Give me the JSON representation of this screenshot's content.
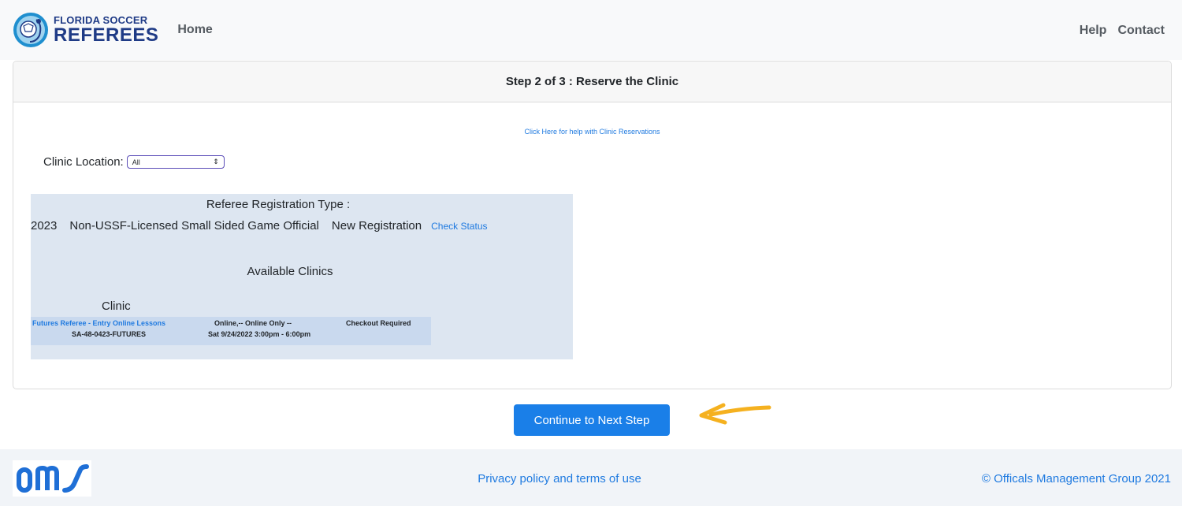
{
  "navbar": {
    "brand_top": "FLORIDA SOCCER",
    "brand_bottom": "REFEREES",
    "home": "Home",
    "help": "Help",
    "contact": "Contact"
  },
  "card": {
    "header": "Step 2 of 3 : Reserve the Clinic",
    "help_link": "Click Here for help with Clinic Reservations",
    "location_label": "Clinic Location:",
    "location_value": "All"
  },
  "registration": {
    "type_label": "Referee Registration Type :",
    "year": "2023",
    "official": "Non-USSF-Licensed Small Sided Game Official",
    "kind": "New Registration",
    "check_status": "Check Status",
    "available_clinics": "Available Clinics",
    "clinic_heading": "Clinic"
  },
  "clinics": [
    {
      "name": "Futures Referee - Entry Online Lessons",
      "location": "Online,-- Online Only --",
      "status": "Checkout Required",
      "code": "SA-48-0423-FUTURES",
      "datetime": "Sat 9/24/2022  3:00pm - 6:00pm"
    }
  ],
  "actions": {
    "continue": "Continue to Next Step"
  },
  "footer": {
    "privacy": "Privacy policy and terms of use",
    "copyright": "© Officals Management Group 2021"
  },
  "colors": {
    "link": "#1f7ae0",
    "button": "#1a7fe8",
    "panel": "#dde6f1",
    "arrow": "#f5b11f",
    "brand": "#1f3b86"
  }
}
